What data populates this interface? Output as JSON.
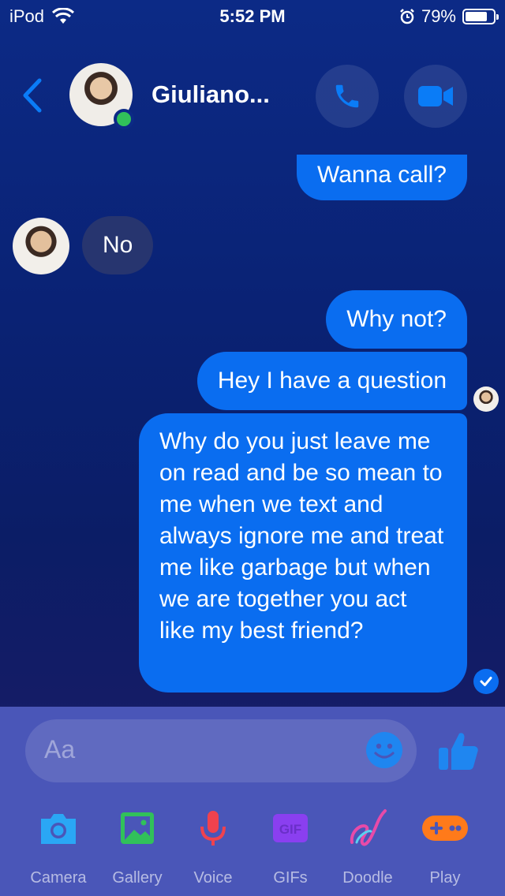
{
  "status_bar": {
    "carrier": "iPod",
    "time": "5:52 PM",
    "battery_percent": "79%",
    "battery_level": 0.79
  },
  "header": {
    "contact_name": "Giuliano...",
    "online": true,
    "call_icon": "phone-icon",
    "video_icon": "video-camera-icon"
  },
  "messages": [
    {
      "direction": "outgoing",
      "text": "Wanna call?"
    },
    {
      "direction": "incoming",
      "text": "No"
    },
    {
      "direction": "outgoing",
      "text": "Why not?"
    },
    {
      "direction": "outgoing",
      "text": "Hey I have a question"
    },
    {
      "direction": "outgoing",
      "text": "Why do you just leave me on read and be so mean to me when we text and always ignore me and treat me like garbage but when we are together you act like my best friend?"
    }
  ],
  "composer": {
    "placeholder": "Aa"
  },
  "tools": [
    {
      "label": "Camera",
      "color": "#2aa7f5"
    },
    {
      "label": "Gallery",
      "color": "#31c15a"
    },
    {
      "label": "Voice",
      "color": "#f0424e"
    },
    {
      "label": "GIFs",
      "color": "#8a3ff0"
    },
    {
      "label": "Doodle",
      "color": "#e84aa8"
    },
    {
      "label": "Play",
      "color": "#ff7a1a"
    }
  ],
  "colors": {
    "accent": "#0a6df0",
    "incoming_bubble": "#27356f",
    "online": "#31c15a"
  }
}
